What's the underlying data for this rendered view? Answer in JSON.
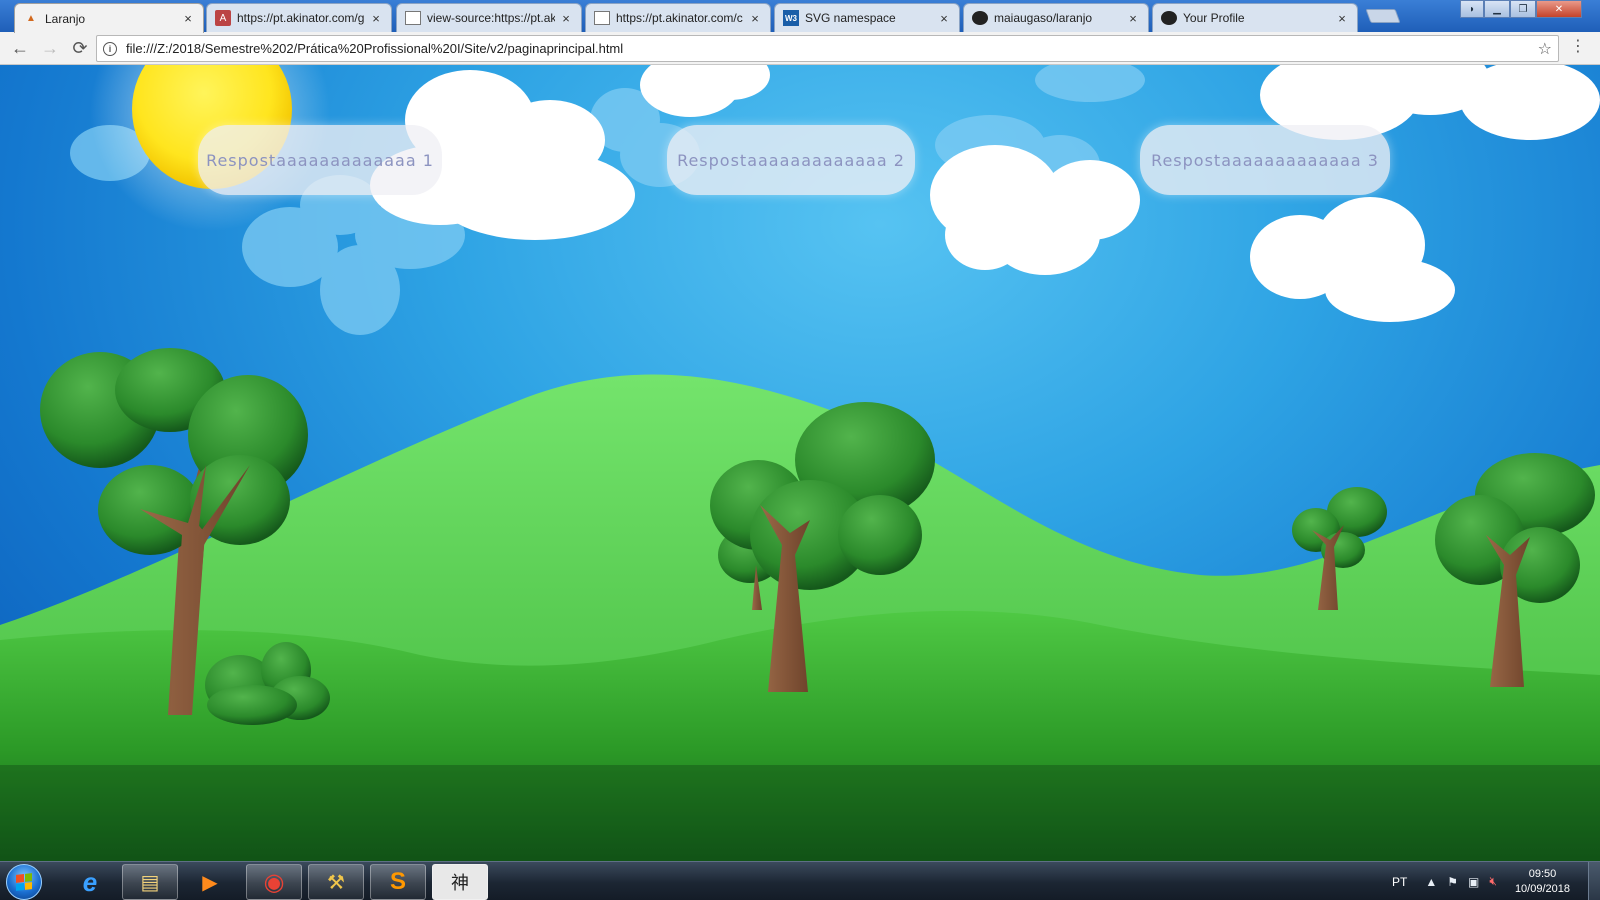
{
  "browser": {
    "tabs": [
      {
        "title": "Laranjo",
        "favicon": "orange-tree-icon",
        "active": true
      },
      {
        "title": "https://pt.akinator.com/g",
        "favicon": "akinator-icon",
        "active": false
      },
      {
        "title": "view-source:https://pt.ak",
        "favicon": "page-icon",
        "active": false
      },
      {
        "title": "https://pt.akinator.com/c",
        "favicon": "page-icon",
        "active": false
      },
      {
        "title": "SVG namespace",
        "favicon": "w3c-icon",
        "active": false
      },
      {
        "title": "maiaugaso/laranjo",
        "favicon": "github-icon",
        "active": false
      },
      {
        "title": "Your Profile",
        "favicon": "github-icon",
        "active": false
      }
    ],
    "close_glyph": "×",
    "address": "file:///Z:/2018/Semestre%202/Prática%20Profissional%20I/Site/v2/paginaprincipal.html",
    "info_glyph": "i",
    "back_glyph": "←",
    "forward_glyph": "→",
    "reload_glyph": "⟳",
    "star_glyph": "☆",
    "menu_glyph": "⋮"
  },
  "page": {
    "answers": [
      {
        "label": "Respostaaaaaaaaaaaaa 1"
      },
      {
        "label": "Respostaaaaaaaaaaaaa 2"
      },
      {
        "label": "Respostaaaaaaaaaaaaa 3"
      }
    ],
    "colors": {
      "button_text": "#8c93c0",
      "sky_top": "#56c3f2",
      "sky_bottom": "#0b59b6",
      "hill_light": "#6fe26a",
      "grass_dark": "#1e7a1c",
      "trunk": "#8b5a3c",
      "sun": "#ffe832"
    }
  },
  "taskbar": {
    "pinned": [
      {
        "name": "internet-explorer",
        "glyph": "e"
      },
      {
        "name": "file-explorer",
        "glyph": "▤"
      },
      {
        "name": "media-player",
        "glyph": "▶"
      },
      {
        "name": "chrome",
        "glyph": "◉"
      },
      {
        "name": "tools",
        "glyph": "⚒"
      },
      {
        "name": "sublime-text",
        "glyph": "S"
      },
      {
        "name": "kanji-app",
        "glyph": "神"
      }
    ],
    "language": "PT",
    "time": "09:50",
    "date": "10/09/2018"
  }
}
